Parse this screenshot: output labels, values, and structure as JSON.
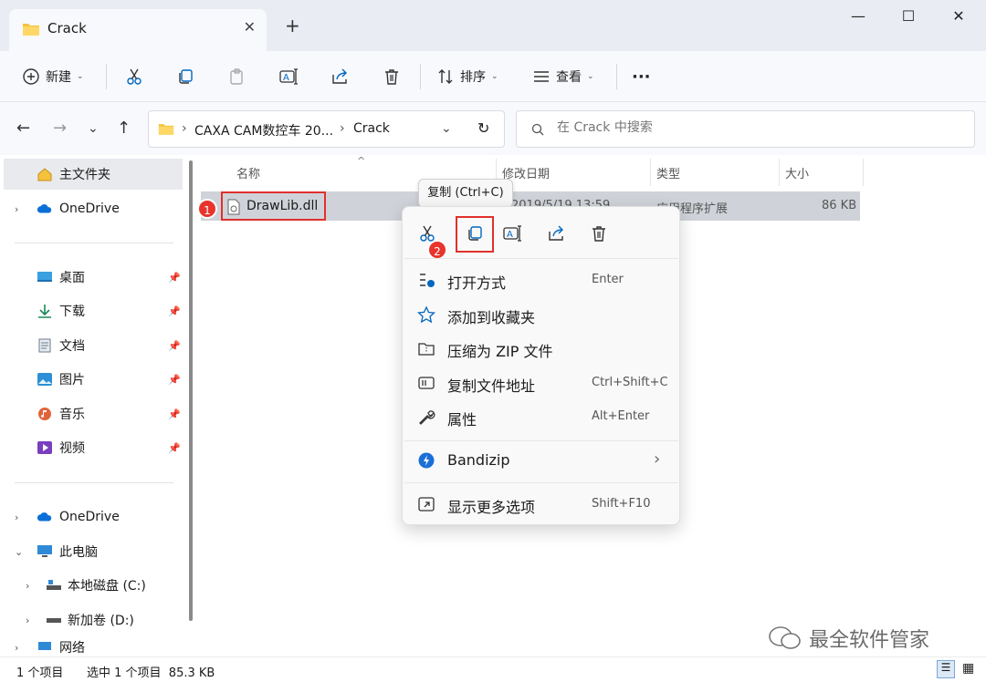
{
  "window": {
    "tab_title": "Crack",
    "new_tab": "+",
    "controls": {
      "minimize": "—",
      "maximize": "☐",
      "close": "✕"
    }
  },
  "toolbar": {
    "new_label": "新建",
    "sort_label": "排序",
    "view_label": "查看",
    "more_label": "···"
  },
  "address": {
    "crumbs": [
      "CAXA CAM数控车 20...",
      "Crack"
    ],
    "separator": "›"
  },
  "search": {
    "placeholder": "在 Crack 中搜索"
  },
  "sidebar": {
    "home": "主文件夹",
    "onedrive1": "OneDrive",
    "quick": [
      "桌面",
      "下载",
      "文档",
      "图片",
      "音乐",
      "视频"
    ],
    "onedrive2": "OneDrive",
    "this_pc": "此电脑",
    "drive_c": "本地磁盘 (C:)",
    "drive_d": "新加卷 (D:)",
    "network": "网络"
  },
  "columns": {
    "name": "名称",
    "modified": "修改日期",
    "type": "类型",
    "size": "大小"
  },
  "file": {
    "name": "DrawLib.dll",
    "modified": "2019/5/19 13:59",
    "type": "应用程序扩展",
    "size": "86 KB"
  },
  "annotations": {
    "badge1": "1",
    "badge2": "2"
  },
  "tooltip": "复制 (Ctrl+C)",
  "context_menu": {
    "items": [
      {
        "label": "打开方式",
        "shortcut": "Enter",
        "icon": "open-with-icon"
      },
      {
        "label": "添加到收藏夹",
        "shortcut": "",
        "icon": "star-icon"
      },
      {
        "label": "压缩为 ZIP 文件",
        "shortcut": "",
        "icon": "zip-icon"
      },
      {
        "label": "复制文件地址",
        "shortcut": "Ctrl+Shift+C",
        "icon": "copy-path-icon"
      },
      {
        "label": "属性",
        "shortcut": "Alt+Enter",
        "icon": "wrench-icon"
      },
      {
        "label": "Bandizip",
        "shortcut": "",
        "icon": "bandizip-icon"
      },
      {
        "label": "显示更多选项",
        "shortcut": "Shift+F10",
        "icon": "more-options-icon"
      }
    ]
  },
  "status": {
    "count": "1 个项目",
    "selected": "选中 1 个项目  85.3 KB"
  },
  "watermark": "最全软件管家",
  "colors": {
    "accent": "#0067c0",
    "highlight_red": "#e0302b",
    "selection": "#cfd3d9"
  }
}
